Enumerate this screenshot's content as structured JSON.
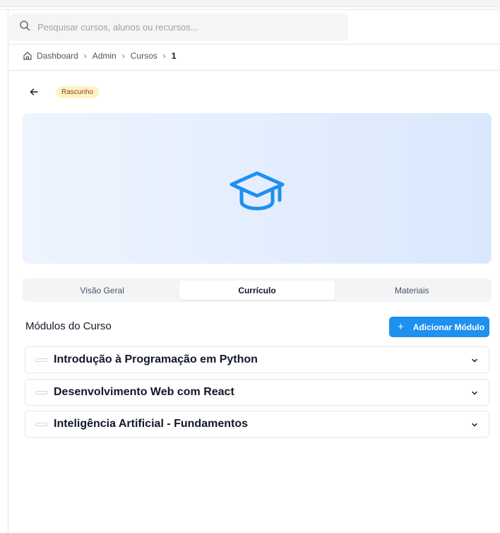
{
  "search": {
    "placeholder": "Pesquisar cursos, alunos ou recursos..."
  },
  "breadcrumb": {
    "items": [
      "Dashboard",
      "Admin",
      "Cursos"
    ],
    "current": "1"
  },
  "course": {
    "status": "Rascunho"
  },
  "tabs": [
    {
      "label": "Visão Geral",
      "active": false
    },
    {
      "label": "Currículo",
      "active": true
    },
    {
      "label": "Materiais",
      "active": false
    }
  ],
  "curriculum": {
    "title": "Módulos do Curso",
    "add_button_label": "Adicionar Módulo",
    "modules": [
      {
        "title": "Introdução à Programação em Python"
      },
      {
        "title": "Desenvolvimento Web com React"
      },
      {
        "title": "Inteligência Artificial - Fundamentos"
      }
    ]
  },
  "colors": {
    "accent": "#1e90f0",
    "badge_bg": "#fef3c7",
    "badge_text": "#92400e"
  },
  "icons": {
    "search": "search-icon",
    "home": "home-icon",
    "back": "arrow-left-icon",
    "hero": "graduation-cap-icon",
    "add": "plus-icon",
    "expand": "chevron-down-icon"
  }
}
